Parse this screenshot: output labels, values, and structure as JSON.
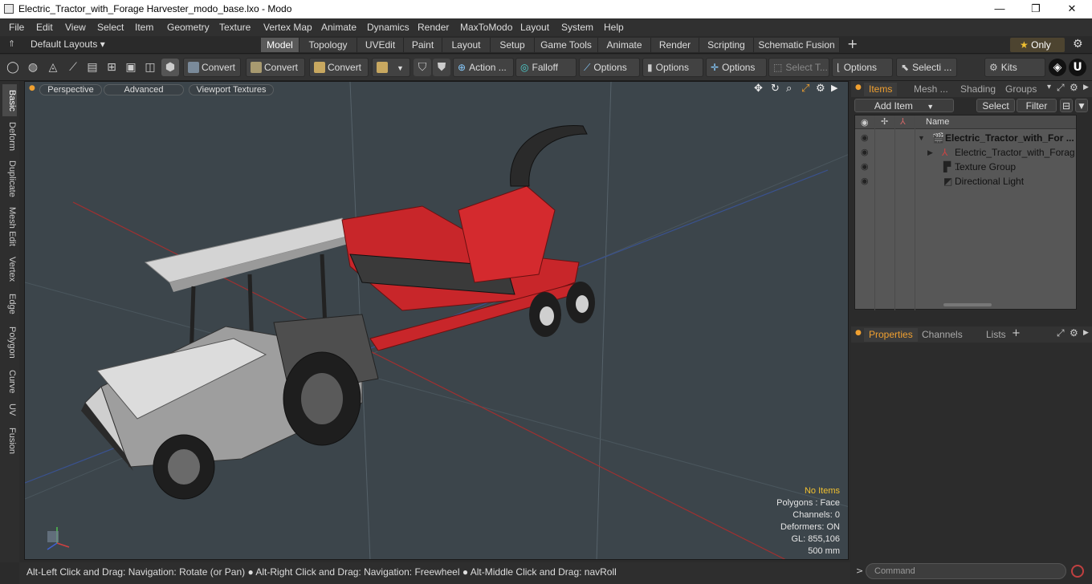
{
  "window": {
    "title": "Electric_Tractor_with_Forage Harvester_modo_base.lxo - Modo",
    "minimize_glyph": "—",
    "maximize_glyph": "❐",
    "close_glyph": "✕"
  },
  "menu": [
    "File",
    "Edit",
    "View",
    "Select",
    "Item",
    "Geometry",
    "Texture",
    "Vertex Map",
    "Animate",
    "Dynamics",
    "Render",
    "MaxToModo",
    "Layout",
    "System",
    "Help"
  ],
  "layout_selector": "Default Layouts",
  "tabs": [
    "Model",
    "Topology",
    "UVEdit",
    "Paint",
    "Layout",
    "Setup",
    "Game Tools",
    "Animate",
    "Render",
    "Scripting",
    "Schematic Fusion"
  ],
  "active_tab": "Model",
  "only_label": "Only",
  "toolbar": {
    "convert1": "Convert",
    "convert2": "Convert",
    "convert3": "Convert",
    "action": "Action ...",
    "falloff": "Falloff",
    "options1": "Options",
    "options2": "Options",
    "options3": "Options",
    "select_t": "Select T...",
    "options4": "Options",
    "selecti": "Selecti ...",
    "kits": "Kits"
  },
  "left_tabs": [
    "Basic",
    "Deform",
    "Duplicate",
    "Mesh Edit",
    "Vertex",
    "Edge",
    "Polygon",
    "Curve",
    "UV",
    "Fusion"
  ],
  "viewport": {
    "perspective": "Perspective",
    "advanced": "Advanced",
    "viewport_textures": "Viewport Textures",
    "info": {
      "no_items": "No Items",
      "polygons": "Polygons : Face",
      "channels": "Channels: 0",
      "deformers": "Deformers: ON",
      "gl": "GL: 855,106",
      "scale": "500 mm"
    }
  },
  "status": "Alt-Left Click and Drag: Navigation: Rotate (or Pan) ● Alt-Right Click and Drag: Navigation: Freewheel ● Alt-Middle Click and Drag: navRoll",
  "items_panel": {
    "tabs": [
      "Items",
      "Mesh ...",
      "Shading",
      "Groups"
    ],
    "add_item": "Add Item",
    "select": "Select",
    "filter": "Filter",
    "name_header": "Name",
    "rows": [
      "Electric_Tractor_with_For ...",
      "Electric_Tractor_with_Forag ...",
      "Texture Group",
      "Directional Light"
    ]
  },
  "properties_panel": {
    "tabs": [
      "Properties",
      "Channels",
      "Lists"
    ],
    "plus": "+"
  },
  "command_placeholder": "Command",
  "colors": {
    "accent": "#f0a030",
    "viewport_bg": "#3c454b",
    "panel_bg": "#2b2b2b",
    "harvester_red": "#c8262a"
  }
}
